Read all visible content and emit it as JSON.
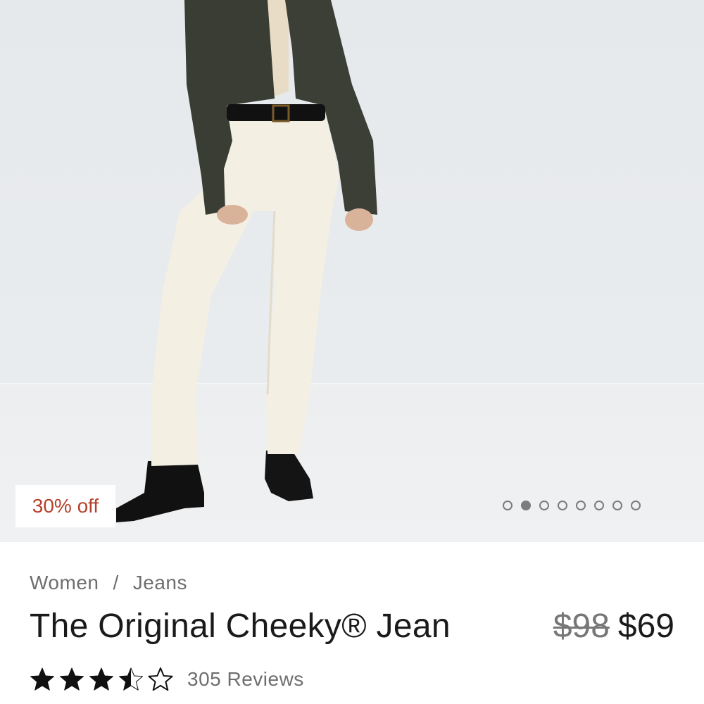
{
  "product_image": {
    "badge": "30% off",
    "carousel": {
      "total": 8,
      "active_index": 1
    }
  },
  "breadcrumb": {
    "level1": "Women",
    "separator": "/",
    "level2": "Jeans"
  },
  "product": {
    "title": "The Original Cheeky® Jean",
    "original_price": "$98",
    "sale_price": "$69"
  },
  "rating": {
    "stars": 3.5,
    "max_stars": 5,
    "reviews": "305 Reviews"
  },
  "colors": {
    "badge_text": "#b5412b",
    "jeans": "#f3efe3",
    "shirt": "#3a3d33"
  }
}
